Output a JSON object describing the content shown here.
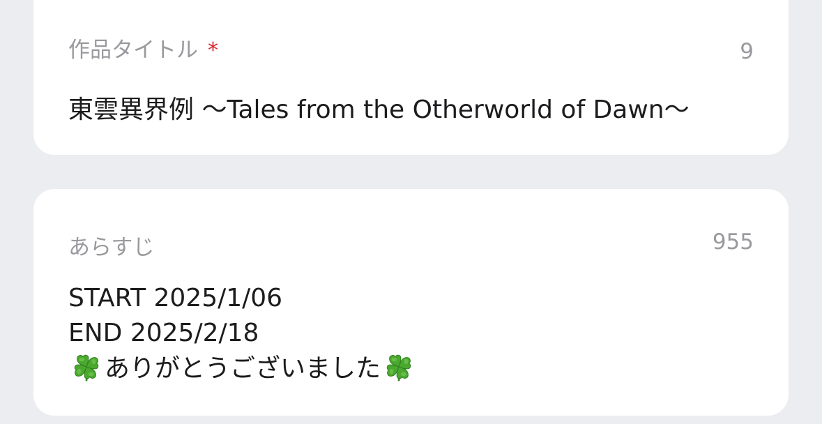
{
  "title_field": {
    "label": "作品タイトル",
    "required_mark": "*",
    "count": "9",
    "value": "東雲異界例 〜Tales from the Otherworld of Dawn〜"
  },
  "synopsis_field": {
    "label": "あらすじ",
    "count": "955",
    "lines": [
      "START 2025/1/06",
      "END 2025/2/18"
    ],
    "closing": {
      "icon": "four-leaf-clover-icon",
      "text": "ありがとうございました"
    }
  },
  "colors": {
    "background": "#ecedf1",
    "card": "#ffffff",
    "label": "#9a9a9e",
    "text": "#1c1c1e",
    "required": "#d8202a",
    "clover": "#4aa82e"
  }
}
